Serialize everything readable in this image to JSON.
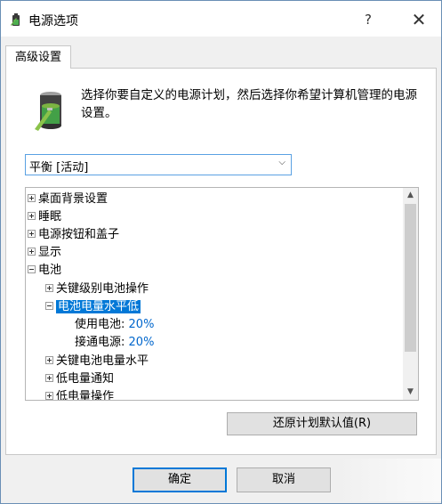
{
  "window": {
    "title": "电源选项",
    "help_label": "?",
    "close_label": "✕",
    "icon": "power-battery-icon"
  },
  "tabs": [
    {
      "label": "高级设置"
    }
  ],
  "description": "选择你要自定义的电源计划，然后选择你希望计算机管理的电源设置。",
  "plan_select": {
    "value": "平衡 [活动]",
    "arrow": "⌵"
  },
  "tree": {
    "items": [
      {
        "label": "桌面背景设置"
      },
      {
        "label": "睡眠"
      },
      {
        "label": "电源按钮和盖子"
      },
      {
        "label": "显示"
      },
      {
        "label": "电池"
      },
      {
        "label": "关键级别电池操作"
      },
      {
        "label": "电池电量水平低"
      },
      {
        "label": "使用电池:",
        "value": "20%"
      },
      {
        "label": "接通电源:",
        "value": "20%"
      },
      {
        "label": "关键电池电量水平"
      },
      {
        "label": "低电量通知"
      },
      {
        "label": "低电量操作"
      }
    ],
    "scroll_up": "▲",
    "scroll_down": "▼"
  },
  "restore_button": "还原计划默认值(R)",
  "ok_button": "确定",
  "cancel_button": "取消",
  "colors": {
    "accent": "#0078d7",
    "value_blue": "#0066cc",
    "dialog_bg": "#f0f0f0"
  }
}
